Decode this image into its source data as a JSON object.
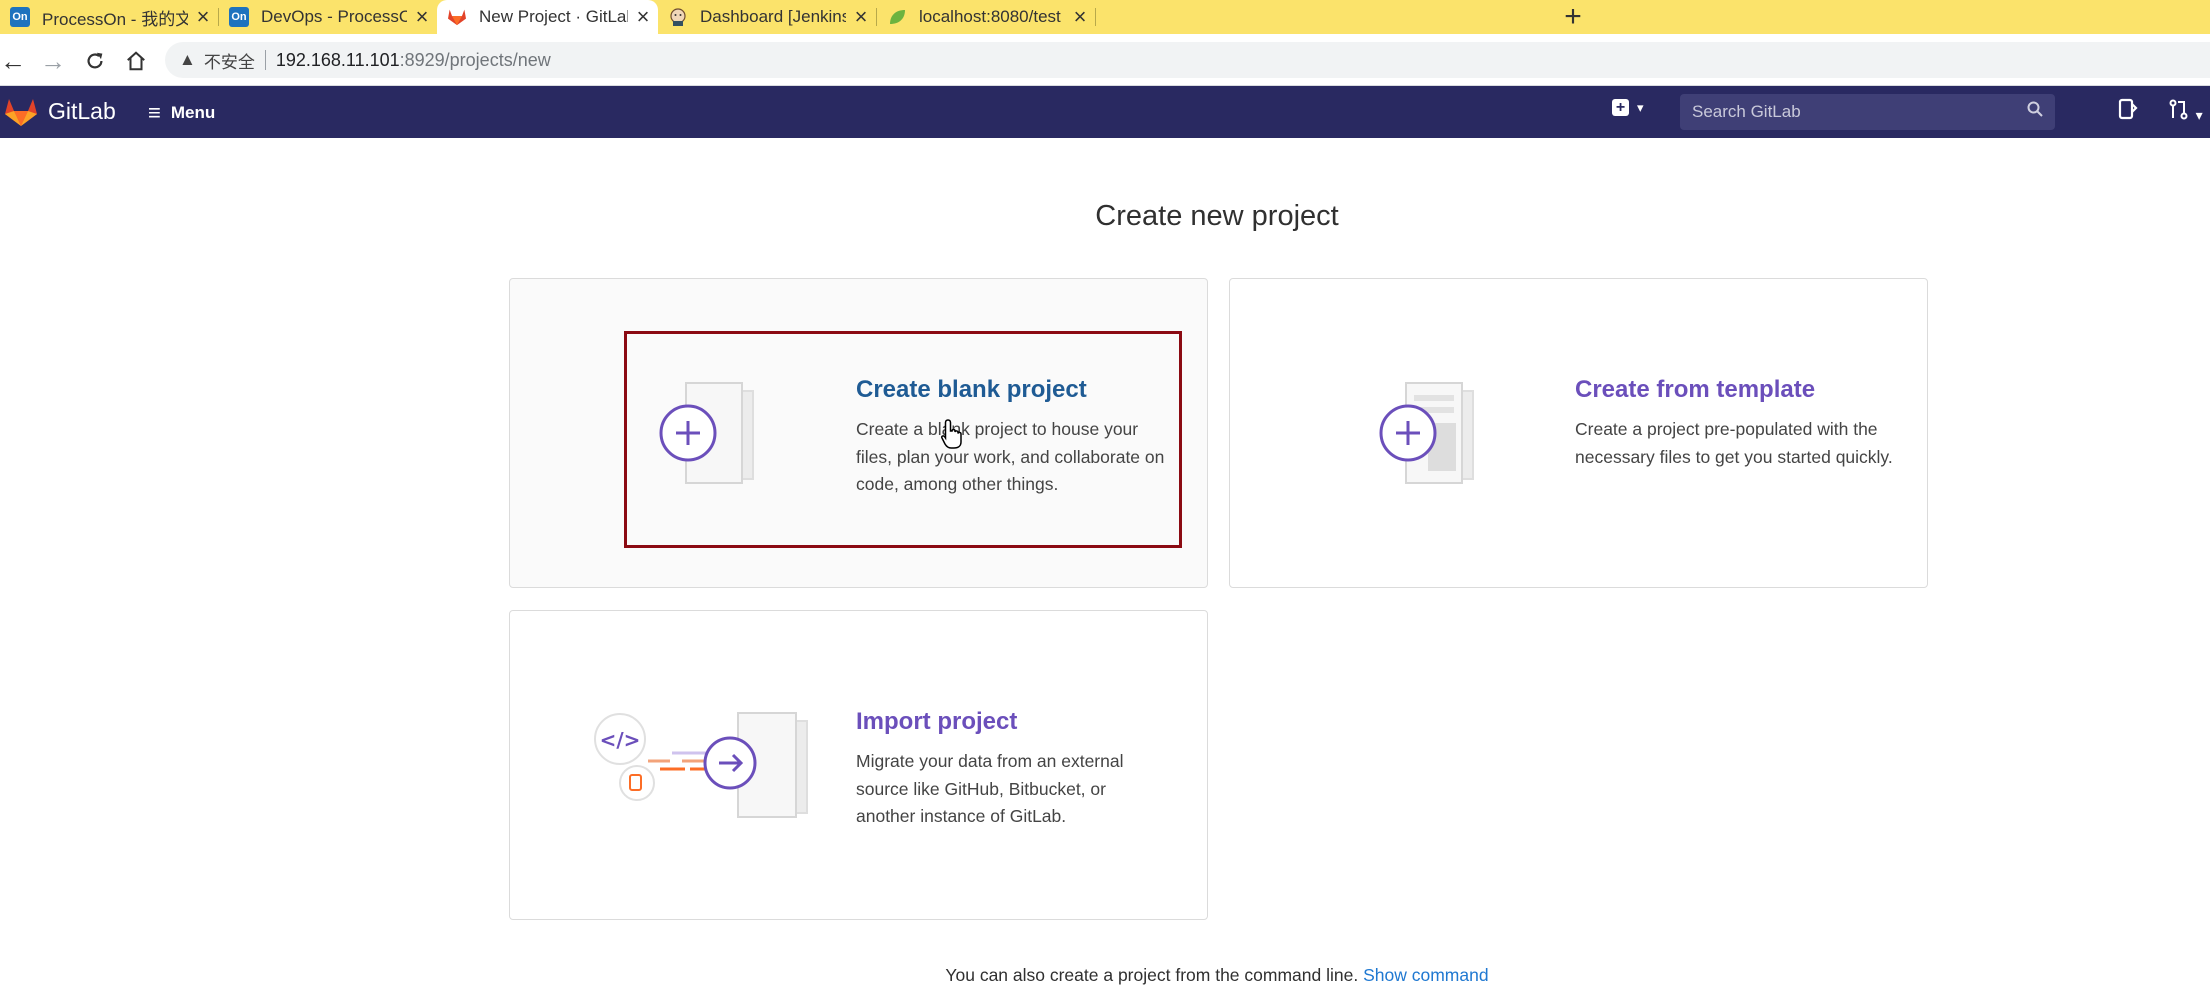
{
  "browser": {
    "tabs": [
      {
        "title": "ProcessOn - 我的文件",
        "icon": "processon-icon",
        "icon_text": "On",
        "active": false
      },
      {
        "title": "DevOps - ProcessOn",
        "icon": "processon-icon",
        "icon_text": "On",
        "active": false
      },
      {
        "title": "New Project · GitLab",
        "icon": "gitlab-icon",
        "icon_text": "",
        "active": true
      },
      {
        "title": "Dashboard [Jenkins]",
        "icon": "jenkins-icon",
        "icon_text": "",
        "active": false
      },
      {
        "title": "localhost:8080/test",
        "icon": "spring-leaf-icon",
        "icon_text": "",
        "active": false
      }
    ],
    "address": {
      "security_label": "不安全",
      "host": "192.168.11.101",
      "path": ":8929/projects/new"
    }
  },
  "header": {
    "brand": "GitLab",
    "menu_label": "Menu",
    "search_placeholder": "Search GitLab"
  },
  "main": {
    "title": "Create new project",
    "cards": {
      "blank": {
        "title": "Create blank project",
        "description": "Create a blank project to house your files, plan your work, and collaborate on code, among other things."
      },
      "template": {
        "title": "Create from template",
        "description": "Create a project pre-populated with the necessary files to get you started quickly."
      },
      "import": {
        "title": "Import project",
        "description": "Migrate your data from an external source like GitHub, Bitbucket, or another instance of GitLab."
      }
    },
    "footer": {
      "text": "You can also create a project from the command line.",
      "link": "Show command"
    }
  },
  "colors": {
    "tabbar_bg": "#fbe36b",
    "gitlab_header_bg": "#292961",
    "card_title_purple": "#6b4fbb",
    "card_title_blue": "#1f5b94",
    "highlight_border": "#8b0a12",
    "link_blue": "#1f78d1"
  }
}
